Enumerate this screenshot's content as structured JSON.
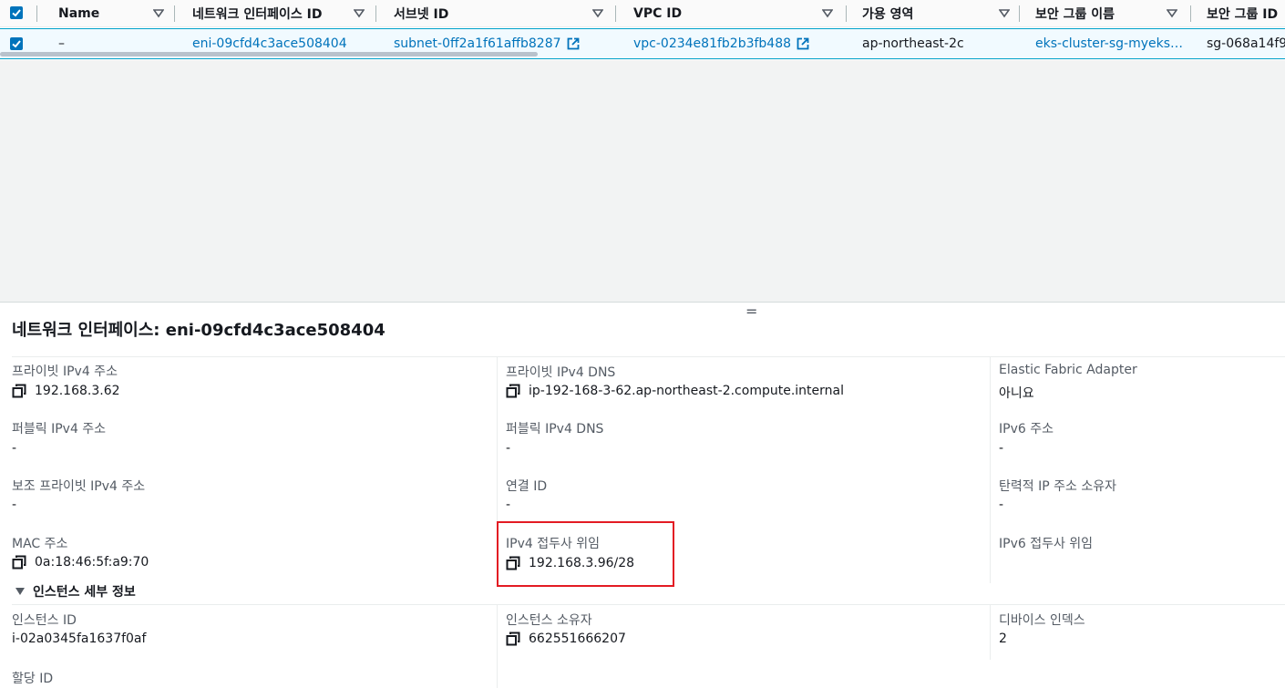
{
  "table": {
    "columns": [
      {
        "label": "Name"
      },
      {
        "label": "네트워크 인터페이스 ID"
      },
      {
        "label": "서브넷 ID"
      },
      {
        "label": "VPC ID"
      },
      {
        "label": "가용 영역"
      },
      {
        "label": "보안 그룹 이름"
      },
      {
        "label": "보안 그룹 ID"
      }
    ],
    "row": {
      "name": "–",
      "eni_id": "eni-09cfd4c3ace508404",
      "subnet_id": "subnet-0ff2a1f61affb8287",
      "vpc_id": "vpc-0234e81fb2b3fb488",
      "az": "ap-northeast-2c",
      "sg_name": "eks-cluster-sg-myeks…",
      "sg_id": "sg-068a14f9"
    }
  },
  "panel": {
    "title": "네트워크 인터페이스: eni-09cfd4c3ace508404",
    "drag_handle": "=",
    "fields": {
      "private_ipv4_label": "프라이빗 IPv4 주소",
      "private_ipv4": "192.168.3.62",
      "private_dns_label": "프라이빗 IPv4 DNS",
      "private_dns": "ip-192-168-3-62.ap-northeast-2.compute.internal",
      "efa_label": "Elastic Fabric Adapter",
      "efa": "아니요",
      "public_ipv4_label": "퍼블릭 IPv4 주소",
      "public_ipv4": "-",
      "public_dns_label": "퍼블릭 IPv4 DNS",
      "public_dns": "-",
      "ipv6_label": "IPv6 주소",
      "ipv6": "-",
      "secondary_ipv4_label": "보조 프라이빗 IPv4 주소",
      "secondary_ipv4": "-",
      "association_label": "연결 ID",
      "association": "-",
      "eip_owner_label": "탄력적 IP 주소 소유자",
      "eip_owner": "-",
      "mac_label": "MAC 주소",
      "mac": "0a:18:46:5f:a9:70",
      "ipv4_prefix_label": "IPv4 접두사 위임",
      "ipv4_prefix": "192.168.3.96/28",
      "ipv6_prefix_label": "IPv6 접두사 위임"
    },
    "instance_section": {
      "title": "인스턴스 세부 정보",
      "instance_id_label": "인스턴스 ID",
      "instance_id": "i-02a0345fa1637f0af",
      "owner_label": "인스턴스 소유자",
      "owner": "662551666207",
      "device_index_label": "디바이스 인덱스",
      "device_index": "2",
      "attachment_id_label": "할당 ID"
    }
  },
  "colors": {
    "accent": "#0073bb",
    "highlight": "#e31b23",
    "selected_row": "#f1faff"
  }
}
